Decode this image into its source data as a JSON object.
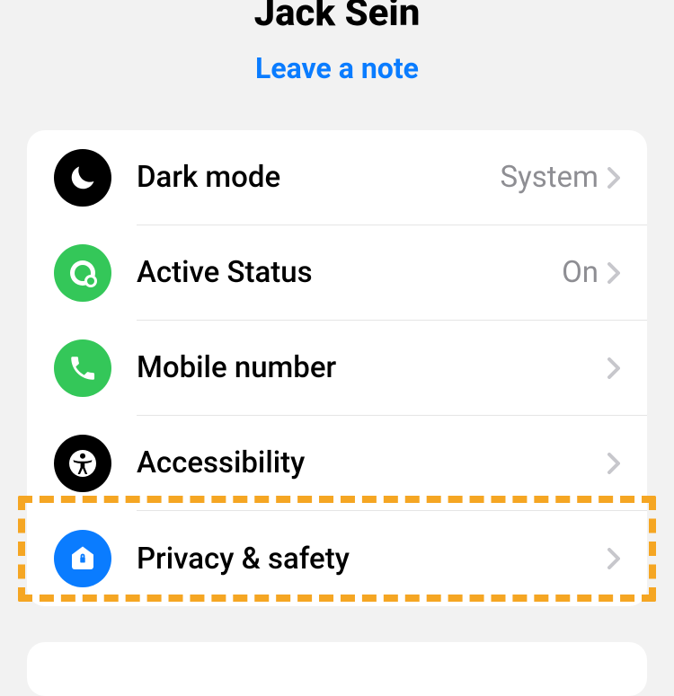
{
  "header": {
    "name": "Jack Sein",
    "leave_note": "Leave a note"
  },
  "rows": [
    {
      "key": "dark-mode",
      "label": "Dark mode",
      "value": "System",
      "icon": "moon",
      "iconBg": "black"
    },
    {
      "key": "active-status",
      "label": "Active Status",
      "value": "On",
      "icon": "status-dot",
      "iconBg": "green"
    },
    {
      "key": "mobile-number",
      "label": "Mobile number",
      "value": "",
      "icon": "phone",
      "iconBg": "green"
    },
    {
      "key": "accessibility",
      "label": "Accessibility",
      "value": "",
      "icon": "accessibility",
      "iconBg": "black"
    },
    {
      "key": "privacy-safety",
      "label": "Privacy & safety",
      "value": "",
      "icon": "shield-home",
      "iconBg": "blue"
    }
  ],
  "highlight": "privacy-safety"
}
